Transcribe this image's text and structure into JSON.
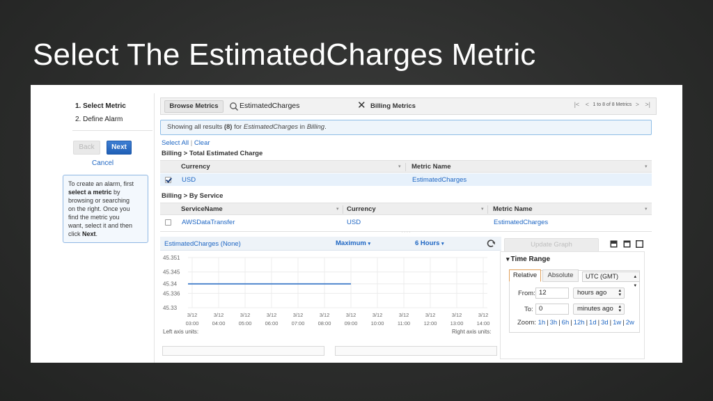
{
  "slide": {
    "title": "Select The EstimatedCharges Metric"
  },
  "wizard": {
    "steps": [
      "1. Select Metric",
      "2. Define Alarm"
    ],
    "back_label": "Back",
    "next_label": "Next",
    "cancel_label": "Cancel",
    "help": {
      "t1": "To create an alarm, first",
      "t2": "select a metric",
      "t3": " by",
      "t4": "browsing or searching",
      "t5": "on the right. Once you",
      "t6": "find the metric you",
      "t7": "want, select it and then",
      "t8": "click ",
      "t9": "Next",
      "t10": "."
    }
  },
  "toolbar": {
    "browse_label": "Browse Metrics",
    "search_value": "EstimatedCharges",
    "clear_label": "✕",
    "namespace_label": "Billing Metrics",
    "pager_text": "1 to 8 of 8 Metrics"
  },
  "results": {
    "p1": "Showing all results ",
    "count": "(8)",
    "p2": " for ",
    "query": "EstimatedCharges",
    "p3": " in ",
    "namespace": "Billing",
    "p4": "."
  },
  "selection": {
    "select_all": "Select All",
    "sep": "|",
    "clear": "Clear"
  },
  "groups": [
    {
      "title": "Billing > Total Estimated Charge",
      "columns": [
        "Currency",
        "Metric Name"
      ],
      "rows": [
        {
          "checked": true,
          "cells": [
            "USD",
            "EstimatedCharges"
          ]
        }
      ]
    },
    {
      "title": "Billing > By Service",
      "columns": [
        "ServiceName",
        "Currency",
        "Metric Name"
      ],
      "rows": [
        {
          "checked": false,
          "cells": [
            "AWSDataTransfer",
            "USD",
            "EstimatedCharges"
          ]
        }
      ]
    }
  ],
  "graph": {
    "title": "EstimatedCharges (None)",
    "statistic": "Maximum",
    "period": "6 Hours",
    "left_axis_label": "Left axis units:",
    "right_axis_label": "Right axis units:"
  },
  "chart_data": {
    "type": "line",
    "ytick_labels": [
      "45.351",
      "45.345",
      "45.34",
      "45.336",
      "45.33"
    ],
    "yticks": [
      45.351,
      45.345,
      45.34,
      45.336,
      45.33
    ],
    "ylim": [
      45.33,
      45.351
    ],
    "x_labels": [
      [
        "3/12",
        "03:00"
      ],
      [
        "3/12",
        "04:00"
      ],
      [
        "3/12",
        "05:00"
      ],
      [
        "3/12",
        "06:00"
      ],
      [
        "3/12",
        "07:00"
      ],
      [
        "3/12",
        "08:00"
      ],
      [
        "3/12",
        "09:00"
      ],
      [
        "3/12",
        "10:00"
      ],
      [
        "3/12",
        "11:00"
      ],
      [
        "3/12",
        "12:00"
      ],
      [
        "3/12",
        "13:00"
      ],
      [
        "3/12",
        "14:00"
      ]
    ],
    "series": [
      {
        "x_start": 0,
        "x_end": 6,
        "value": 45.34
      }
    ],
    "grid": true,
    "series_color": "#3a78c8"
  },
  "side": {
    "update_label": "Update Graph",
    "time_range_label": "Time Range",
    "tabs": [
      "Relative",
      "Absolute"
    ],
    "timezone": "UTC (GMT)",
    "from_label": "From:",
    "from_value": "12",
    "from_unit": "hours ago",
    "to_label": "To:",
    "to_value": "0",
    "to_unit": "minutes ago",
    "zoom_label": "Zoom:",
    "zoom_options": [
      "1h",
      "3h",
      "6h",
      "12h",
      "1d",
      "3d",
      "1w",
      "2w"
    ]
  },
  "colors": {
    "link": "#1e66c3",
    "next_button": "#2b6cc4",
    "selected_row": "#e7f1fb"
  }
}
